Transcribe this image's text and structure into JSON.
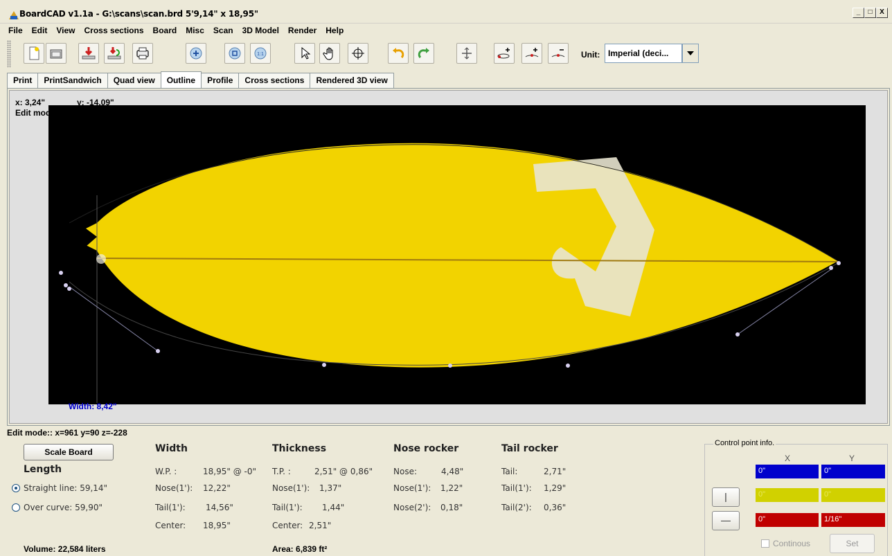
{
  "window": {
    "title": "BoardCAD v1.1a - G:\\scans\\scan.brd  5'9,14\" x 18,95\"",
    "minimize": "_",
    "maximize": "□",
    "close": "X"
  },
  "menu": [
    "File",
    "Edit",
    "View",
    "Cross sections",
    "Board",
    "Misc",
    "Scan",
    "3D Model",
    "Render",
    "Help"
  ],
  "toolbar": {
    "unit_label": "Unit:",
    "unit_value": "Imperial (deci...",
    "icons": [
      "new-file-icon",
      "open-folder-icon",
      "save-icon",
      "save-as-icon",
      "print-icon",
      "zoom-in-icon",
      "zoom-fit-icon",
      "zoom-reset-icon",
      "select-pointer-icon",
      "pan-hand-icon",
      "rotate-icon",
      "undo-icon",
      "redo-icon",
      "flip-icon",
      "add-point-icon",
      "add-point-2-icon",
      "remove-point-icon"
    ]
  },
  "tabs": [
    "Print",
    "PrintSandwich",
    "Quad view",
    "Outline",
    "Profile",
    "Cross sections",
    "Rendered 3D view"
  ],
  "active_tab": "Outline",
  "canvas": {
    "coord_x": "x: 3,24\"",
    "coord_y": "y: -14,09\"",
    "mode": "Edit mode",
    "width_label": "Width: 8,42\""
  },
  "status": "Edit mode:: x=961 y=90 z=-228",
  "length": {
    "scale_button": "Scale Board",
    "heading": "Length",
    "straight": "Straight line: 59,14\"",
    "curve": "Over curve: 59,90\""
  },
  "width": {
    "heading": "Width",
    "rows": [
      {
        "label": "W.P. :",
        "value": "18,95\" @ -0\""
      },
      {
        "label": "Nose(1'):",
        "value": "12,22\""
      },
      {
        "label": "Tail(1'):",
        "value": "14,56\""
      },
      {
        "label": "Center:",
        "value": "18,95\""
      }
    ]
  },
  "thickness": {
    "heading": "Thickness",
    "rows": [
      {
        "label": "T.P. :",
        "value": "2,51\" @ 0,86\""
      },
      {
        "label": "Nose(1'):",
        "value": "1,37\""
      },
      {
        "label": "Tail(1'):",
        "value": "1,44\""
      },
      {
        "label": "Center:",
        "value": "2,51\""
      }
    ]
  },
  "nose_rocker": {
    "heading": "Nose rocker",
    "rows": [
      {
        "label": "Nose:",
        "value": "4,48\""
      },
      {
        "label": "Nose(1'):",
        "value": "1,22\""
      },
      {
        "label": "Nose(2'):",
        "value": "0,18\""
      }
    ]
  },
  "tail_rocker": {
    "heading": "Tail rocker",
    "rows": [
      {
        "label": "Tail:",
        "value": "2,71\""
      },
      {
        "label": "Tail(1'):",
        "value": "1,29\""
      },
      {
        "label": "Tail(2'):",
        "value": "0,36\""
      }
    ]
  },
  "volume": "Volume: 22,584 liters",
  "area": "Area: 6,839 ft²",
  "control_point": {
    "title": "Control point info.",
    "col_x": "X",
    "col_y": "Y",
    "blue_x": "0\"",
    "blue_y": "0\"",
    "yellow_x": "0\"",
    "yellow_y": "0\"",
    "red_x": "0\"",
    "red_y": "1/16\"",
    "btn_vertical": "|",
    "btn_horizontal": "—",
    "continous": "Continous",
    "set": "Set"
  },
  "colors": {
    "board": "#f2d300",
    "canvas_bg": "#000000",
    "width_label": "#0000cc"
  }
}
